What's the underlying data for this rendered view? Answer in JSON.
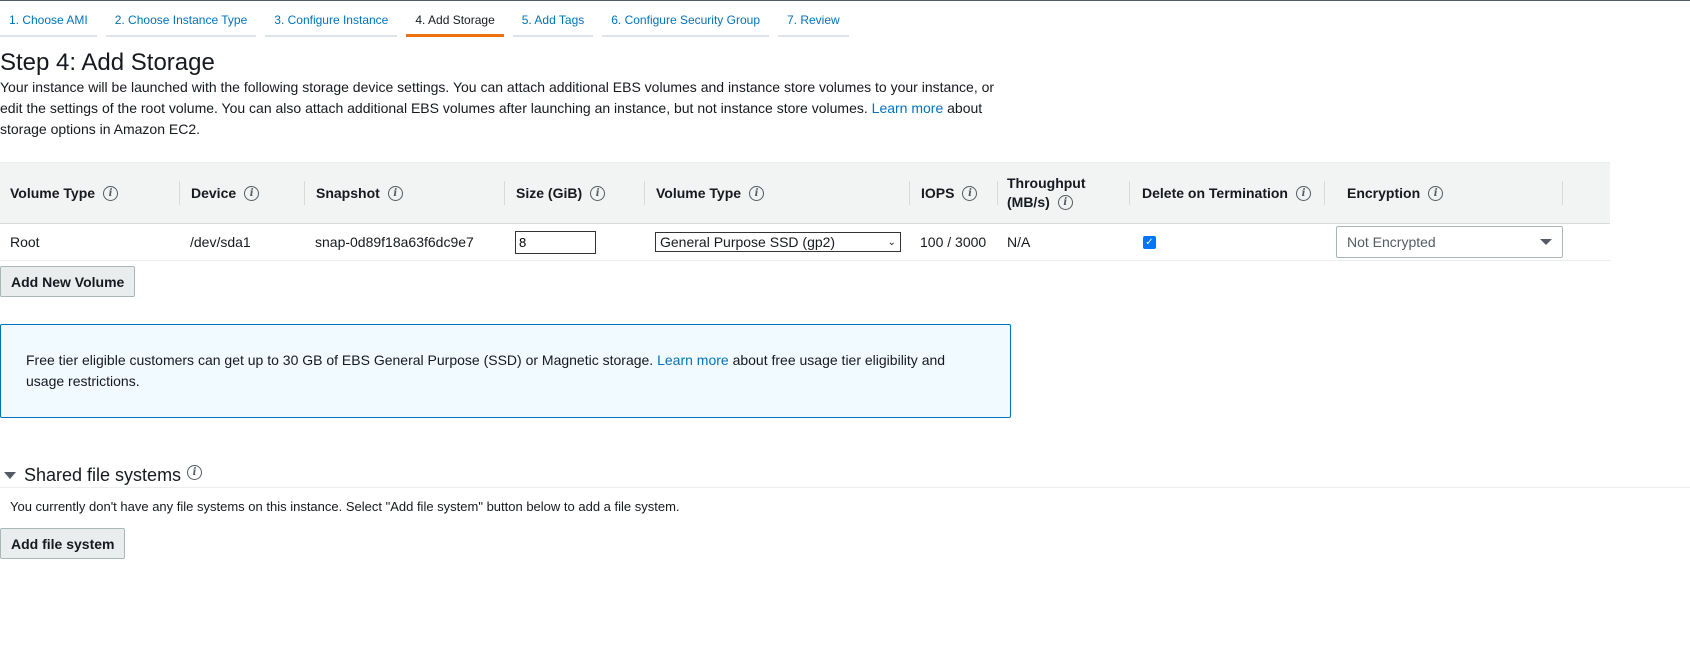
{
  "wizard": {
    "steps": [
      "1. Choose AMI",
      "2. Choose Instance Type",
      "3. Configure Instance",
      "4. Add Storage",
      "5. Add Tags",
      "6. Configure Security Group",
      "7. Review"
    ],
    "active_index": 3
  },
  "page": {
    "title": "Step 4: Add Storage",
    "desc_part1": "Your instance will be launched with the following storage device settings. You can attach additional EBS volumes and instance store volumes to your instance, or edit the settings of the root volume. You can also attach additional EBS volumes after launching an instance, but not instance store volumes.",
    "desc_link": "Learn more",
    "desc_part2": "about storage options in Amazon EC2."
  },
  "table": {
    "headers": {
      "volume_type": "Volume Type",
      "device": "Device",
      "snapshot": "Snapshot",
      "size": "Size (GiB)",
      "volume_type2": "Volume Type",
      "iops": "IOPS",
      "throughput_line1": "Throughput",
      "throughput_line2": "(MB/s)",
      "delete_on_termination": "Delete on Termination",
      "encryption": "Encryption"
    },
    "row": {
      "volume_type": "Root",
      "device": "/dev/sda1",
      "snapshot": "snap-0d89f18a63f6dc9e7",
      "size": "8",
      "volume_type_select": "General Purpose SSD (gp2)",
      "iops": "100 / 3000",
      "throughput": "N/A",
      "delete_on_termination": true,
      "encryption": "Not Encrypted"
    }
  },
  "buttons": {
    "add_volume": "Add New Volume",
    "add_file_system": "Add file system"
  },
  "notice": {
    "text1": "Free tier eligible customers can get up to 30 GB of EBS General Purpose (SSD) or Magnetic storage.",
    "link": "Learn more",
    "text2": "about free usage tier eligibility and usage restrictions."
  },
  "shared": {
    "title": "Shared file systems",
    "desc": "You currently don't have any file systems on this instance. Select \"Add file system\" button below to add a file system."
  },
  "colors": {
    "link": "#0073bb",
    "active_tab": "#ec7211",
    "notice_bg": "#f1faff",
    "checkbox": "#0075ff"
  }
}
